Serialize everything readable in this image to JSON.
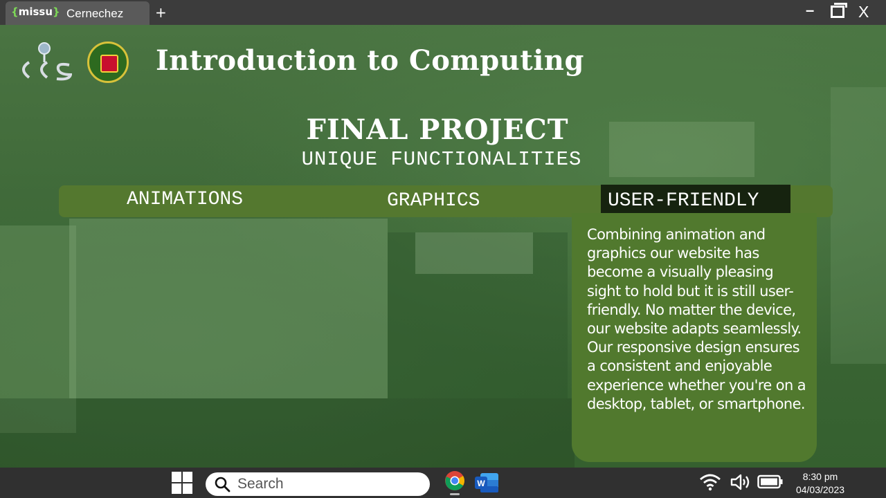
{
  "browser": {
    "tab_logo": "missu",
    "tab_title": "Cernechez",
    "new_tab_label": "+",
    "minimize_label": "–",
    "close_label": "X"
  },
  "slide": {
    "course_title": "Introduction to Computing",
    "heading": "FINAL PROJECT",
    "subheading": "UNIQUE FUNCTIONALITIES",
    "tabs": [
      {
        "label": "ANIMATIONS",
        "active": false
      },
      {
        "label": "GRAPHICS",
        "active": false
      },
      {
        "label": "USER-FRIENDLY",
        "active": true
      }
    ],
    "description": "Combining animation and graphics our website has become a visually pleasing sight to hold but it is still user-friendly. No matter the device, our website adapts seamlessly. Our responsive design ensures a consistent and enjoyable experience whether you're on a desktop, tablet, or smartphone.",
    "colors": {
      "tab_bar": "#54782f",
      "active_tab": "#16230f",
      "panel": "#51792e"
    }
  },
  "taskbar": {
    "search_placeholder": "Search",
    "time": "8:30 pm",
    "date": "04/03/2023",
    "icons": [
      "windows-start-icon",
      "search-icon",
      "chrome-icon",
      "word-icon",
      "wifi-icon",
      "volume-icon",
      "battery-icon"
    ]
  }
}
